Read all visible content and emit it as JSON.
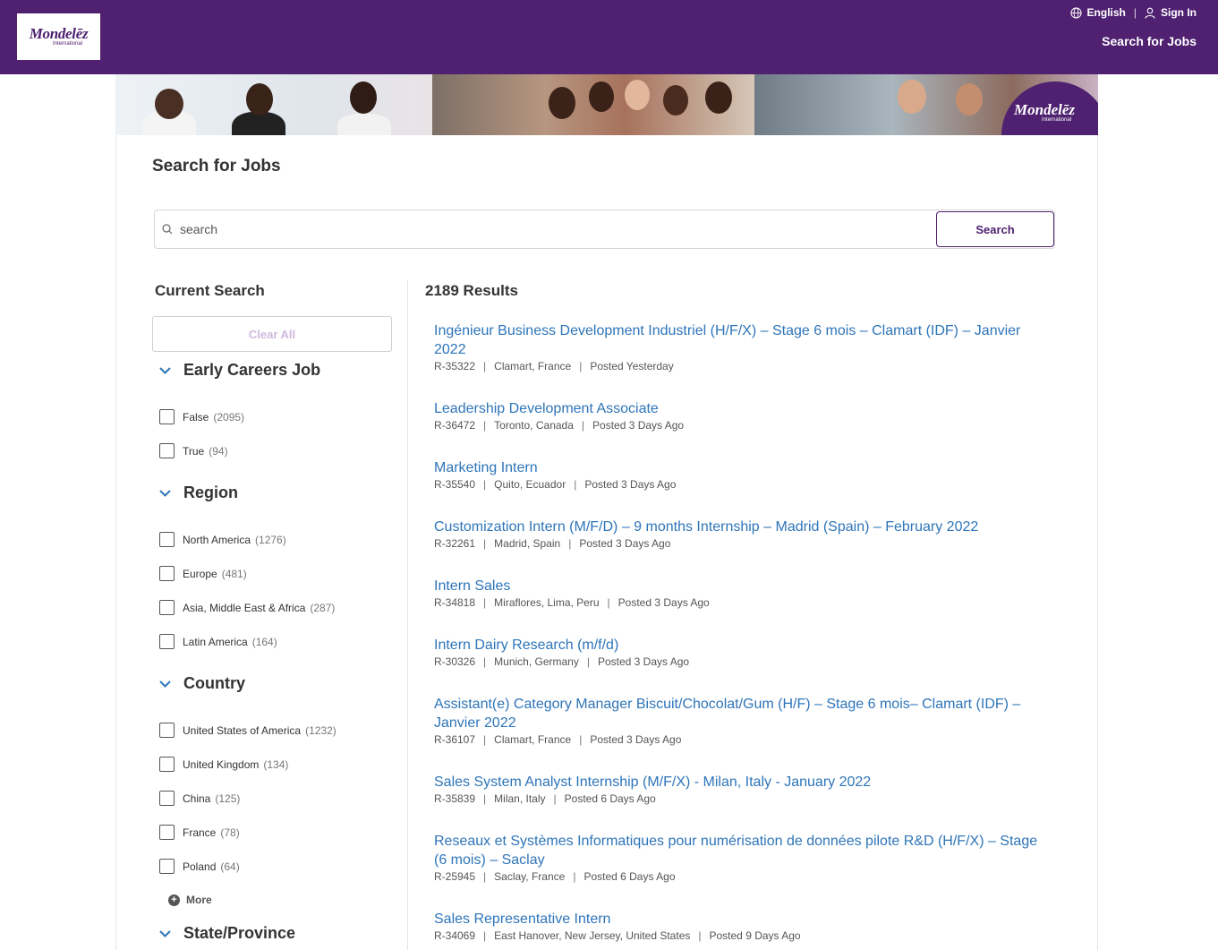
{
  "header": {
    "logo_text": "Mondelēz",
    "logo_sub": "International",
    "language": "English",
    "sign_in": "Sign In",
    "nav_search": "Search for Jobs"
  },
  "banner": {
    "seal_text": "Mondelēz",
    "seal_sub": "International"
  },
  "page": {
    "title": "Search for Jobs",
    "search_placeholder": "search",
    "search_button": "Search"
  },
  "sidebar": {
    "current_search": "Current Search",
    "clear_all": "Clear All",
    "facets": [
      {
        "title": "Early Careers Job",
        "options": [
          {
            "label": "False",
            "count": "(2095)"
          },
          {
            "label": "True",
            "count": "(94)"
          }
        ]
      },
      {
        "title": "Region",
        "options": [
          {
            "label": "North America",
            "count": "(1276)"
          },
          {
            "label": "Europe",
            "count": "(481)"
          },
          {
            "label": "Asia, Middle East & Africa",
            "count": "(287)"
          },
          {
            "label": "Latin America",
            "count": "(164)"
          }
        ]
      },
      {
        "title": "Country",
        "options": [
          {
            "label": "United States of America",
            "count": "(1232)"
          },
          {
            "label": "United Kingdom",
            "count": "(134)"
          },
          {
            "label": "China",
            "count": "(125)"
          },
          {
            "label": "France",
            "count": "(78)"
          },
          {
            "label": "Poland",
            "count": "(64)"
          }
        ]
      },
      {
        "title": "State/Province",
        "options": []
      }
    ],
    "more": "More"
  },
  "results": {
    "count": "2189 Results",
    "jobs": [
      {
        "title": "Ingénieur Business Development Industriel (H/F/X) – Stage 6 mois – Clamart (IDF) – Janvier 2022",
        "id": "R-35322",
        "location": "Clamart, France",
        "posted": "Posted Yesterday"
      },
      {
        "title": "Leadership Development Associate",
        "id": "R-36472",
        "location": "Toronto, Canada",
        "posted": "Posted 3 Days Ago"
      },
      {
        "title": "Marketing Intern",
        "id": "R-35540",
        "location": "Quito, Ecuador",
        "posted": "Posted 3 Days Ago"
      },
      {
        "title": "Customization Intern (M/F/D) – 9 months Internship – Madrid (Spain) – February 2022",
        "id": "R-32261",
        "location": "Madrid, Spain",
        "posted": "Posted 3 Days Ago"
      },
      {
        "title": "Intern Sales",
        "id": "R-34818",
        "location": "Miraflores, Lima, Peru",
        "posted": "Posted 3 Days Ago"
      },
      {
        "title": "Intern Dairy Research (m/f/d)",
        "id": "R-30326",
        "location": "Munich, Germany",
        "posted": "Posted 3 Days Ago"
      },
      {
        "title": "Assistant(e) Category Manager Biscuit/Chocolat/Gum (H/F) – Stage 6 mois– Clamart (IDF) – Janvier 2022",
        "id": "R-36107",
        "location": "Clamart, France",
        "posted": "Posted 3 Days Ago"
      },
      {
        "title": "Sales System Analyst Internship (M/F/X) - Milan, Italy - January 2022",
        "id": "R-35839",
        "location": "Milan, Italy",
        "posted": "Posted 6 Days Ago"
      },
      {
        "title": "Reseaux et Systèmes Informatiques pour numérisation de données pilote R&D (H/F/X) – Stage (6 mois) – Saclay",
        "id": "R-25945",
        "location": "Saclay, France",
        "posted": "Posted 6 Days Ago"
      },
      {
        "title": "Sales Representative Intern",
        "id": "R-34069",
        "location": "East Hanover, New Jersey, United States",
        "posted": "Posted 9 Days Ago"
      }
    ]
  },
  "colors": {
    "brand": "#4f2170",
    "link": "#2e75b9",
    "clear_all": "#cfb9dd"
  }
}
